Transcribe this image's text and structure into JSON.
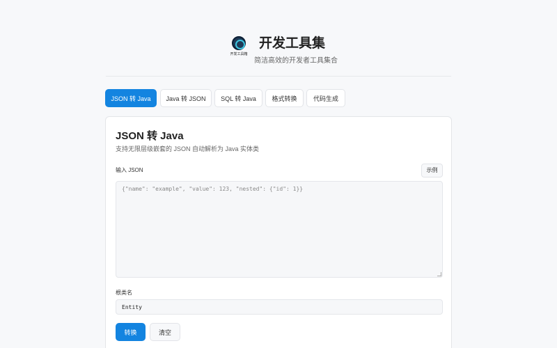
{
  "header": {
    "logo_text": "开发工具箱",
    "title": "开发工具集",
    "subtitle": "简洁高效的开发者工具集合"
  },
  "tabs": [
    {
      "label": "JSON 转 Java",
      "active": true
    },
    {
      "label": "Java 转 JSON",
      "active": false
    },
    {
      "label": "SQL 转 Java",
      "active": false
    },
    {
      "label": "格式转换",
      "active": false
    },
    {
      "label": "代码生成",
      "active": false
    }
  ],
  "panel": {
    "title": "JSON 转 Java",
    "description": "支持无限层级嵌套的 JSON 自动解析为 Java 实体类",
    "json_label": "输入 JSON",
    "example_button": "示例",
    "json_placeholder": "{\"name\": \"example\", \"value\": 123, \"nested\": {\"id\": 1}}",
    "class_name_label": "根类名",
    "class_name_value": "Entity",
    "convert_button": "转换",
    "clear_button": "清空"
  },
  "colors": {
    "accent": "#1384e0",
    "background": "#f7f8fa",
    "logo": "#1f3a57"
  }
}
